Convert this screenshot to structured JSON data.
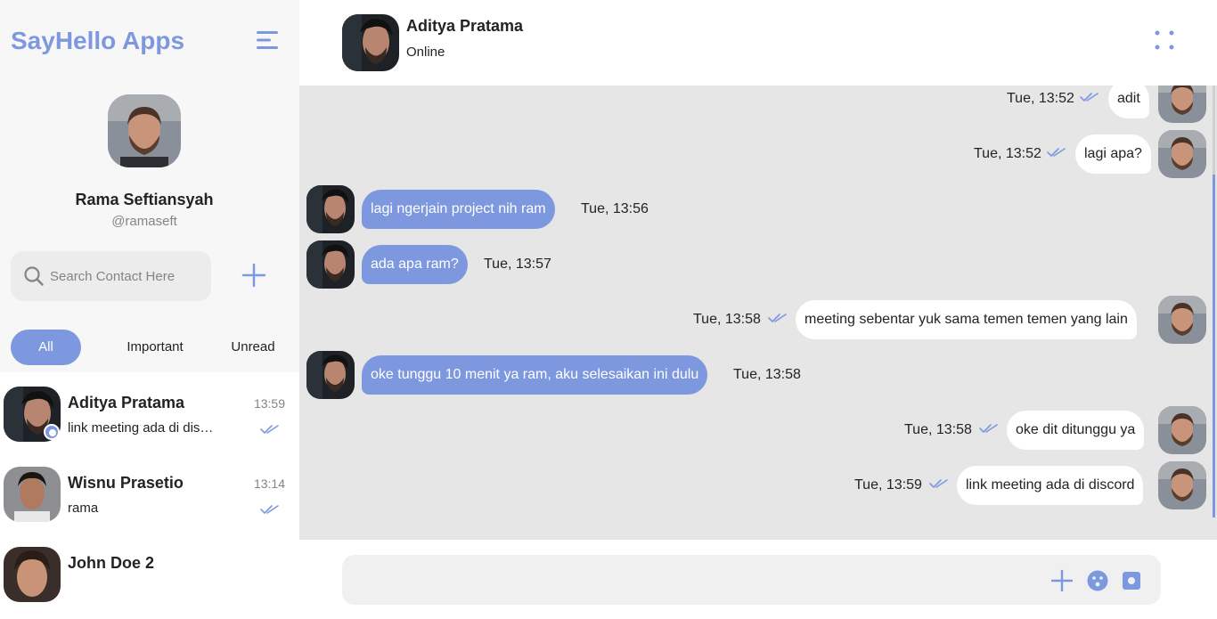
{
  "sidebar": {
    "brand": "SayHello Apps",
    "menu_icon": "hamburger-menu-icon",
    "profile": {
      "name": "Rama Seftiansyah",
      "handle": "@ramaseft"
    },
    "search": {
      "placeholder": "Search Contact Here",
      "value": ""
    },
    "filter_tabs": [
      {
        "label": "All",
        "active": true
      },
      {
        "label": "Important",
        "active": false
      },
      {
        "label": "Unread",
        "active": false
      }
    ],
    "contacts": [
      {
        "name": "Aditya Pratama",
        "time": "13:59",
        "preview": "link meeting ada di discord",
        "read": true,
        "online": true
      },
      {
        "name": "Wisnu Prasetio",
        "time": "13:14",
        "preview": "rama",
        "read": true,
        "online": false
      },
      {
        "name": "John Doe 2",
        "time": "",
        "preview": "",
        "read": false,
        "online": false
      }
    ]
  },
  "chat": {
    "header": {
      "name": "Aditya Pratama",
      "status": "Online",
      "options_icon": "grid-dots-icon"
    },
    "messages": [
      {
        "direction": "out",
        "text": "adit",
        "time": "Tue, 13:52",
        "read": true
      },
      {
        "direction": "out",
        "text": "lagi apa?",
        "time": "Tue, 13:52",
        "read": true
      },
      {
        "direction": "in",
        "text": "lagi ngerjain project nih ram",
        "time": "Tue, 13:56"
      },
      {
        "direction": "in",
        "text": "ada apa ram?",
        "time": "Tue, 13:57"
      },
      {
        "direction": "out",
        "text": "meeting sebentar yuk sama temen temen yang lain",
        "time": "Tue, 13:58",
        "read": true
      },
      {
        "direction": "in",
        "text": "oke tunggu 10 menit ya ram, aku selesaikan ini dulu",
        "time": "Tue, 13:58"
      },
      {
        "direction": "out",
        "text": "oke dit ditunggu ya",
        "time": "Tue, 13:58",
        "read": true
      },
      {
        "direction": "out",
        "text": "link meeting ada di discord",
        "time": "Tue, 13:59",
        "read": true
      }
    ],
    "composer": {
      "placeholder": "",
      "value": "",
      "icons": [
        "plus-icon",
        "emoji-icon",
        "camera-icon"
      ]
    }
  },
  "colors": {
    "accent": "#7e98df",
    "chat_bg": "#e6e6e6",
    "sidebar_bg": "#f7f7f7"
  }
}
